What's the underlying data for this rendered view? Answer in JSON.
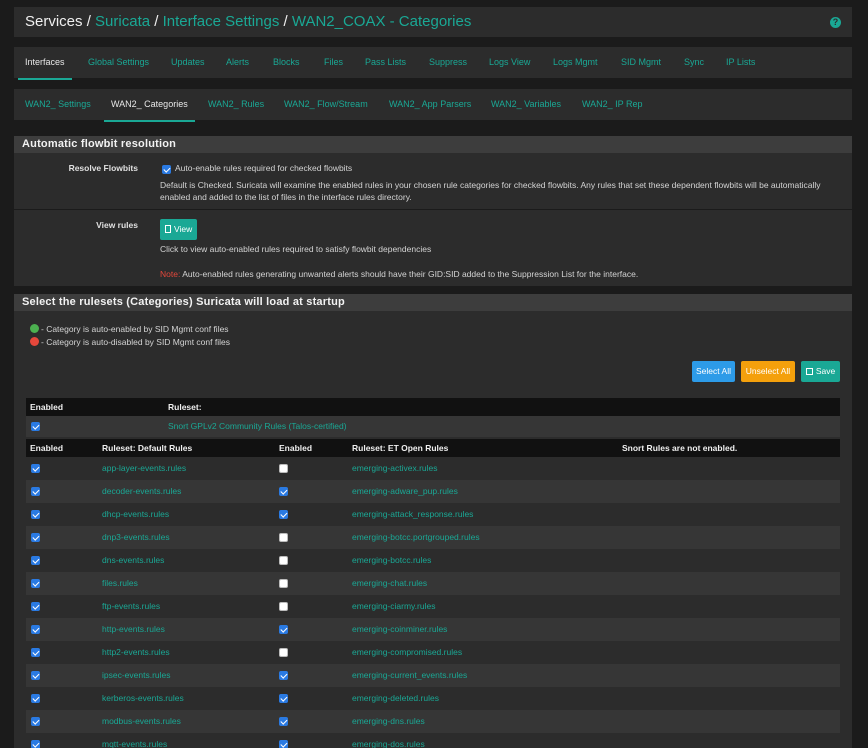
{
  "header": {
    "crumb_root": "Services",
    "crumb_1": "Suricata",
    "crumb_2": "Interface Settings",
    "crumb_3": "WAN2_COAX - Categories",
    "help": "?"
  },
  "main_tabs": [
    "Interfaces",
    "Global Settings",
    "Updates",
    "Alerts",
    "Blocks",
    "Files",
    "Pass Lists",
    "Suppress",
    "Logs View",
    "Logs Mgmt",
    "SID Mgmt",
    "Sync",
    "IP Lists"
  ],
  "sub_tabs": [
    "WAN2_ Settings",
    "WAN2_ Categories",
    "WAN2_ Rules",
    "WAN2_ Flow/Stream",
    "WAN2_ App Parsers",
    "WAN2_ Variables",
    "WAN2_ IP Rep"
  ],
  "flowbit": {
    "title": "Automatic flowbit resolution",
    "resolve_label": "Resolve Flowbits",
    "resolve_checkbox_text": "Auto-enable rules required for checked flowbits",
    "resolve_checked": true,
    "resolve_help_1": "Default is Checked. Suricata will examine the enabled rules in your chosen rule categories for checked flowbits. Any rules that set these dependent flowbits will be automatically",
    "resolve_help_2": "enabled and added to the list of files in the interface rules directory.",
    "view_label": "View rules",
    "view_button": "View",
    "view_help": "Click to view auto-enabled rules required to satisfy flowbit dependencies",
    "note_label": "Note:",
    "note_text": "Auto-enabled rules generating unwanted alerts should have their GID:SID added to the Suppression List for the interface."
  },
  "rulesets": {
    "title": "Select the rulesets (Categories) Suricata will load at startup",
    "legend_enabled": "- Category is auto-enabled by SID Mgmt conf files",
    "legend_disabled": "- Category is auto-disabled by SID Mgmt conf files",
    "select_all": "Select All",
    "unselect_all": "Unselect All",
    "save": "Save",
    "top_header": {
      "enabled": "Enabled",
      "ruleset": "Ruleset:"
    },
    "community": {
      "checked": true,
      "name": "Snort GPLv2 Community Rules (Talos-certified)"
    },
    "header": {
      "enabled1": "Enabled",
      "ruleset_default": "Ruleset: Default Rules",
      "enabled2": "Enabled",
      "ruleset_et": "Ruleset: ET Open Rules",
      "snort_note": "Snort Rules are not enabled."
    },
    "rows": [
      {
        "d_checked": true,
        "d_name": "app-layer-events.rules",
        "e_checked": false,
        "e_name": "emerging-activex.rules"
      },
      {
        "d_checked": true,
        "d_name": "decoder-events.rules",
        "e_checked": true,
        "e_name": "emerging-adware_pup.rules"
      },
      {
        "d_checked": true,
        "d_name": "dhcp-events.rules",
        "e_checked": true,
        "e_name": "emerging-attack_response.rules"
      },
      {
        "d_checked": true,
        "d_name": "dnp3-events.rules",
        "e_checked": false,
        "e_name": "emerging-botcc.portgrouped.rules"
      },
      {
        "d_checked": true,
        "d_name": "dns-events.rules",
        "e_checked": false,
        "e_name": "emerging-botcc.rules"
      },
      {
        "d_checked": true,
        "d_name": "files.rules",
        "e_checked": false,
        "e_name": "emerging-chat.rules"
      },
      {
        "d_checked": true,
        "d_name": "ftp-events.rules",
        "e_checked": false,
        "e_name": "emerging-ciarmy.rules"
      },
      {
        "d_checked": true,
        "d_name": "http-events.rules",
        "e_checked": true,
        "e_name": "emerging-coinminer.rules"
      },
      {
        "d_checked": true,
        "d_name": "http2-events.rules",
        "e_checked": false,
        "e_name": "emerging-compromised.rules"
      },
      {
        "d_checked": true,
        "d_name": "ipsec-events.rules",
        "e_checked": true,
        "e_name": "emerging-current_events.rules"
      },
      {
        "d_checked": true,
        "d_name": "kerberos-events.rules",
        "e_checked": true,
        "e_name": "emerging-deleted.rules"
      },
      {
        "d_checked": true,
        "d_name": "modbus-events.rules",
        "e_checked": true,
        "e_name": "emerging-dns.rules"
      },
      {
        "d_checked": true,
        "d_name": "mqtt-events.rules",
        "e_checked": true,
        "e_name": "emerging-dos.rules"
      }
    ]
  },
  "colors": {
    "accent": "#1aa895",
    "note_red": "#e5473b",
    "checkbox_blue": "#2a7ae2"
  }
}
